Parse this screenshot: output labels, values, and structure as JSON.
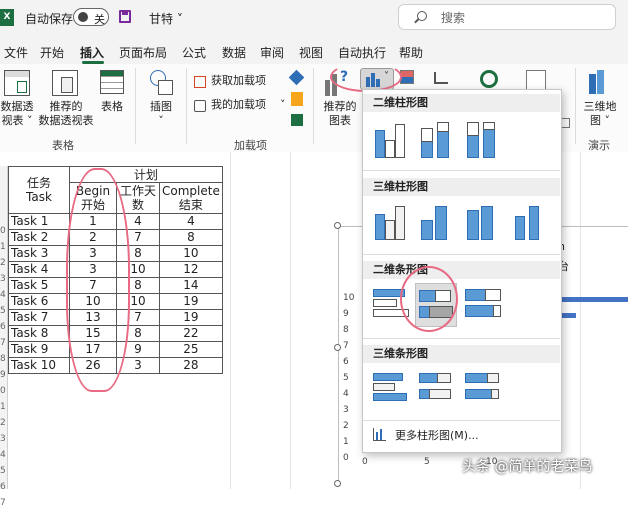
{
  "titlebar": {
    "app_badge": "X",
    "autosave_label": "自动保存",
    "autosave_state": "关",
    "doc_title": "甘特",
    "search_placeholder": "搜索"
  },
  "menu": [
    "文件",
    "开始",
    "插入",
    "页面布局",
    "公式",
    "数据",
    "审阅",
    "视图",
    "自动执行",
    "帮助"
  ],
  "menu_active": "插入",
  "ribbon": {
    "pivot_line1": "数据透",
    "pivot_line2": "视表 ˅",
    "rec_pivot_line1": "推荐的",
    "rec_pivot_line2": "数据透视表",
    "table": "表格",
    "group_tables": "表格",
    "illustrations": "插图",
    "get_addins": "获取加载项",
    "my_addins": "我的加载项",
    "group_addins": "加载项",
    "rec_charts_line1": "推荐的",
    "rec_charts_line2": "图表",
    "map3d_line1": "三维地",
    "map3d_line2": "图 ˅",
    "group_tours": "演示"
  },
  "table": {
    "header_task": "任务\nTask",
    "header_plan": "计划",
    "header_begin": "Begin\n开始",
    "header_days": "工作天\n数",
    "header_complete": "Complete\n结束",
    "rows": [
      [
        "Task 1",
        "1",
        "4",
        "4"
      ],
      [
        "Task 2",
        "2",
        "7",
        "8"
      ],
      [
        "Task 3",
        "3",
        "8",
        "10"
      ],
      [
        "Task 4",
        "3",
        "10",
        "12"
      ],
      [
        "Task 5",
        "7",
        "8",
        "14"
      ],
      [
        "Task 6",
        "10",
        "10",
        "19"
      ],
      [
        "Task 7",
        "13",
        "7",
        "19"
      ],
      [
        "Task 8",
        "15",
        "8",
        "22"
      ],
      [
        "Task 9",
        "17",
        "9",
        "25"
      ],
      [
        "Task 10",
        "26",
        "3",
        "28"
      ]
    ]
  },
  "row_numbers": [
    "0",
    "1",
    "2",
    "3",
    "4",
    "5",
    "6",
    "7",
    "8",
    "9",
    "0",
    "1",
    "2",
    "3",
    "4",
    "5",
    "6",
    "7"
  ],
  "chart_bg": {
    "y_ticks": [
      "10",
      "9",
      "8",
      "7",
      "6",
      "5",
      "4",
      "3",
      "2",
      "1",
      "0"
    ],
    "x_ticks": [
      "0",
      "5",
      "10"
    ],
    "partial_labels": [
      "n",
      "台"
    ]
  },
  "dropdown": {
    "section_2d_column": "二维柱形图",
    "section_3d_column": "三维柱形图",
    "section_2d_bar": "二维条形图",
    "section_3d_bar": "三维条形图",
    "more_link": "更多柱形图(M)..."
  },
  "watermark": "头条 @简单的老菜鸟",
  "colors": {
    "excel_green": "#1d6f42",
    "chart_blue": "#4472c4",
    "highlight_red": "#e86a83",
    "chart_gray": "#a5a5a5"
  }
}
